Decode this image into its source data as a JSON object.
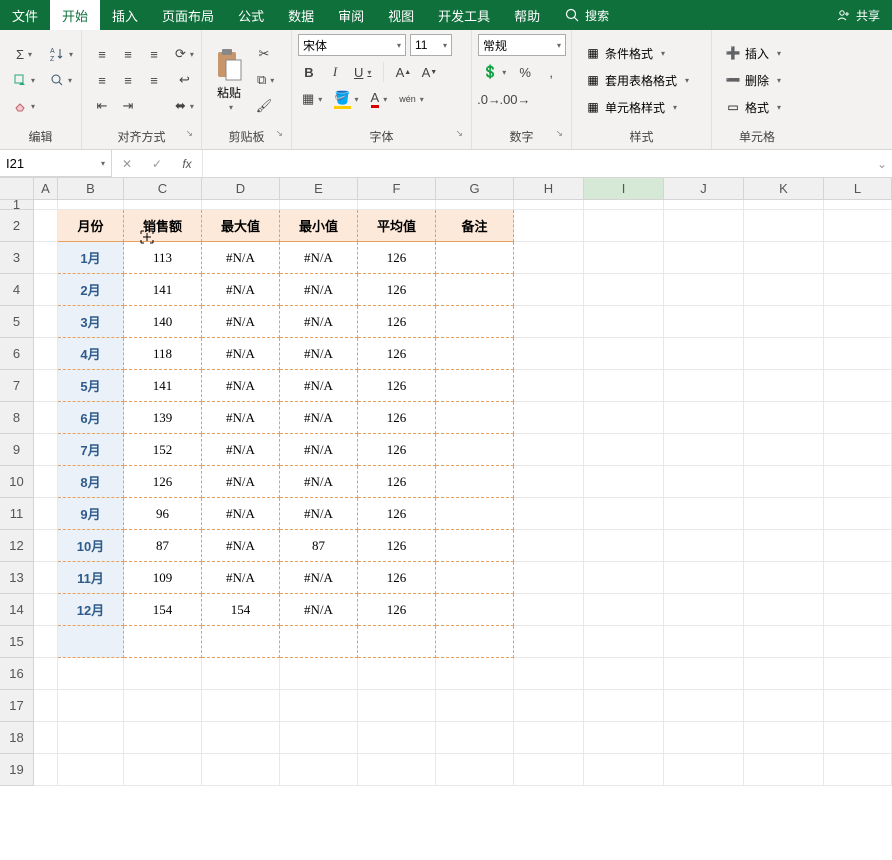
{
  "menubar": {
    "items": [
      "文件",
      "开始",
      "插入",
      "页面布局",
      "公式",
      "数据",
      "审阅",
      "视图",
      "开发工具",
      "帮助"
    ],
    "active_index": 1,
    "search": "搜索",
    "share": "共享"
  },
  "ribbon": {
    "edit": {
      "label": "编辑"
    },
    "align": {
      "label": "对齐方式"
    },
    "clipboard": {
      "label": "剪贴板",
      "paste": "粘贴"
    },
    "font": {
      "label": "字体",
      "family": "宋体",
      "size": "11",
      "buttons": {
        "bold": "B",
        "italic": "I",
        "underline": "U"
      }
    },
    "number": {
      "label": "数字",
      "format": "常规",
      "percent": "%",
      "comma": ","
    },
    "styles": {
      "label": "样式",
      "cond": "条件格式",
      "table": "套用表格格式",
      "cell": "单元格样式"
    },
    "cells": {
      "label": "单元格",
      "insert": "插入",
      "delete": "删除",
      "format": "格式"
    }
  },
  "formulabar": {
    "name": "I21",
    "fx": "fx"
  },
  "columns": [
    "A",
    "B",
    "C",
    "D",
    "E",
    "F",
    "G",
    "H",
    "I",
    "J",
    "K",
    "L"
  ],
  "rownums": [
    "1",
    "2",
    "3",
    "4",
    "5",
    "6",
    "7",
    "8",
    "9",
    "10",
    "11",
    "12",
    "13",
    "14",
    "15",
    "16",
    "17",
    "18",
    "19"
  ],
  "selected_col": "I",
  "table": {
    "headers": [
      "月份",
      "销售额",
      "最大值",
      "最小值",
      "平均值",
      "备注"
    ],
    "rows": [
      {
        "m": "1月",
        "s": "113",
        "max": "#N/A",
        "min": "#N/A",
        "avg": "126",
        "note": ""
      },
      {
        "m": "2月",
        "s": "141",
        "max": "#N/A",
        "min": "#N/A",
        "avg": "126",
        "note": ""
      },
      {
        "m": "3月",
        "s": "140",
        "max": "#N/A",
        "min": "#N/A",
        "avg": "126",
        "note": ""
      },
      {
        "m": "4月",
        "s": "118",
        "max": "#N/A",
        "min": "#N/A",
        "avg": "126",
        "note": ""
      },
      {
        "m": "5月",
        "s": "141",
        "max": "#N/A",
        "min": "#N/A",
        "avg": "126",
        "note": ""
      },
      {
        "m": "6月",
        "s": "139",
        "max": "#N/A",
        "min": "#N/A",
        "avg": "126",
        "note": ""
      },
      {
        "m": "7月",
        "s": "152",
        "max": "#N/A",
        "min": "#N/A",
        "avg": "126",
        "note": ""
      },
      {
        "m": "8月",
        "s": "126",
        "max": "#N/A",
        "min": "#N/A",
        "avg": "126",
        "note": ""
      },
      {
        "m": "9月",
        "s": "96",
        "max": "#N/A",
        "min": "#N/A",
        "avg": "126",
        "note": ""
      },
      {
        "m": "10月",
        "s": "87",
        "max": "#N/A",
        "min": "87",
        "avg": "126",
        "note": ""
      },
      {
        "m": "11月",
        "s": "109",
        "max": "#N/A",
        "min": "#N/A",
        "avg": "126",
        "note": ""
      },
      {
        "m": "12月",
        "s": "154",
        "max": "154",
        "min": "#N/A",
        "avg": "126",
        "note": ""
      }
    ]
  }
}
